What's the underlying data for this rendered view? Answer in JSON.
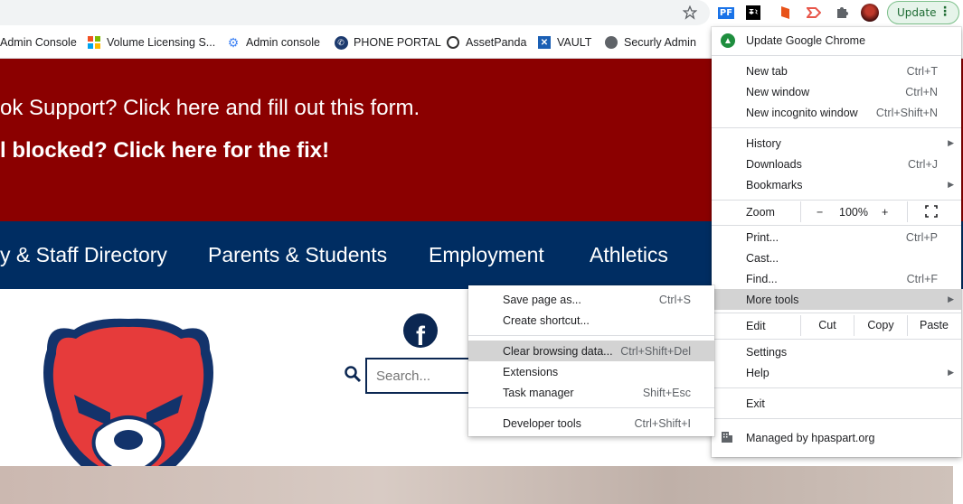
{
  "toolbar": {
    "extensions": [
      "star-icon",
      "pf-extension-icon",
      "dropbox-extension-icon",
      "office-extension-icon",
      "flag-extension-icon",
      "puzzle-extensions-icon",
      "profile-avatar"
    ],
    "update_label": "Update"
  },
  "bookmarks": [
    {
      "label": "Admin Console"
    },
    {
      "label": "Volume Licensing S..."
    },
    {
      "label": "Admin console"
    },
    {
      "label": "PHONE PORTAL"
    },
    {
      "label": "AssetPanda"
    },
    {
      "label": "VAULT"
    },
    {
      "label": "Securly Admin"
    }
  ],
  "page": {
    "banner_line1": "ok Support? Click here and fill out this form.",
    "banner_line2": "l blocked? Click here for the fix!",
    "nav": [
      "y & Staff Directory",
      "Parents & Students",
      "Employment",
      "Athletics"
    ],
    "search_placeholder": "Search..."
  },
  "chrome_menu": {
    "update": "Update Google Chrome",
    "new_tab": {
      "label": "New tab",
      "shortcut": "Ctrl+T"
    },
    "new_window": {
      "label": "New window",
      "shortcut": "Ctrl+N"
    },
    "incognito": {
      "label": "New incognito window",
      "shortcut": "Ctrl+Shift+N"
    },
    "history": "History",
    "downloads": {
      "label": "Downloads",
      "shortcut": "Ctrl+J"
    },
    "bookmarks": "Bookmarks",
    "zoom": {
      "label": "Zoom",
      "minus": "−",
      "value": "100%",
      "plus": "+"
    },
    "print": {
      "label": "Print...",
      "shortcut": "Ctrl+P"
    },
    "cast": "Cast...",
    "find": {
      "label": "Find...",
      "shortcut": "Ctrl+F"
    },
    "more_tools": "More tools",
    "edit": {
      "label": "Edit",
      "cut": "Cut",
      "copy": "Copy",
      "paste": "Paste"
    },
    "settings": "Settings",
    "help": "Help",
    "exit": "Exit",
    "managed": "Managed by hpaspart.org"
  },
  "more_tools_menu": {
    "save_page": {
      "label": "Save page as...",
      "shortcut": "Ctrl+S"
    },
    "create_shortcut": "Create shortcut...",
    "clear_data": {
      "label": "Clear browsing data...",
      "shortcut": "Ctrl+Shift+Del"
    },
    "extensions": "Extensions",
    "task_manager": {
      "label": "Task manager",
      "shortcut": "Shift+Esc"
    },
    "dev_tools": {
      "label": "Developer tools",
      "shortcut": "Ctrl+Shift+I"
    }
  },
  "colors": {
    "banner": "#8b0000",
    "nav": "#002d62",
    "accent_green": "#1e8e3e",
    "menu_highlight": "#d3d3d3"
  }
}
